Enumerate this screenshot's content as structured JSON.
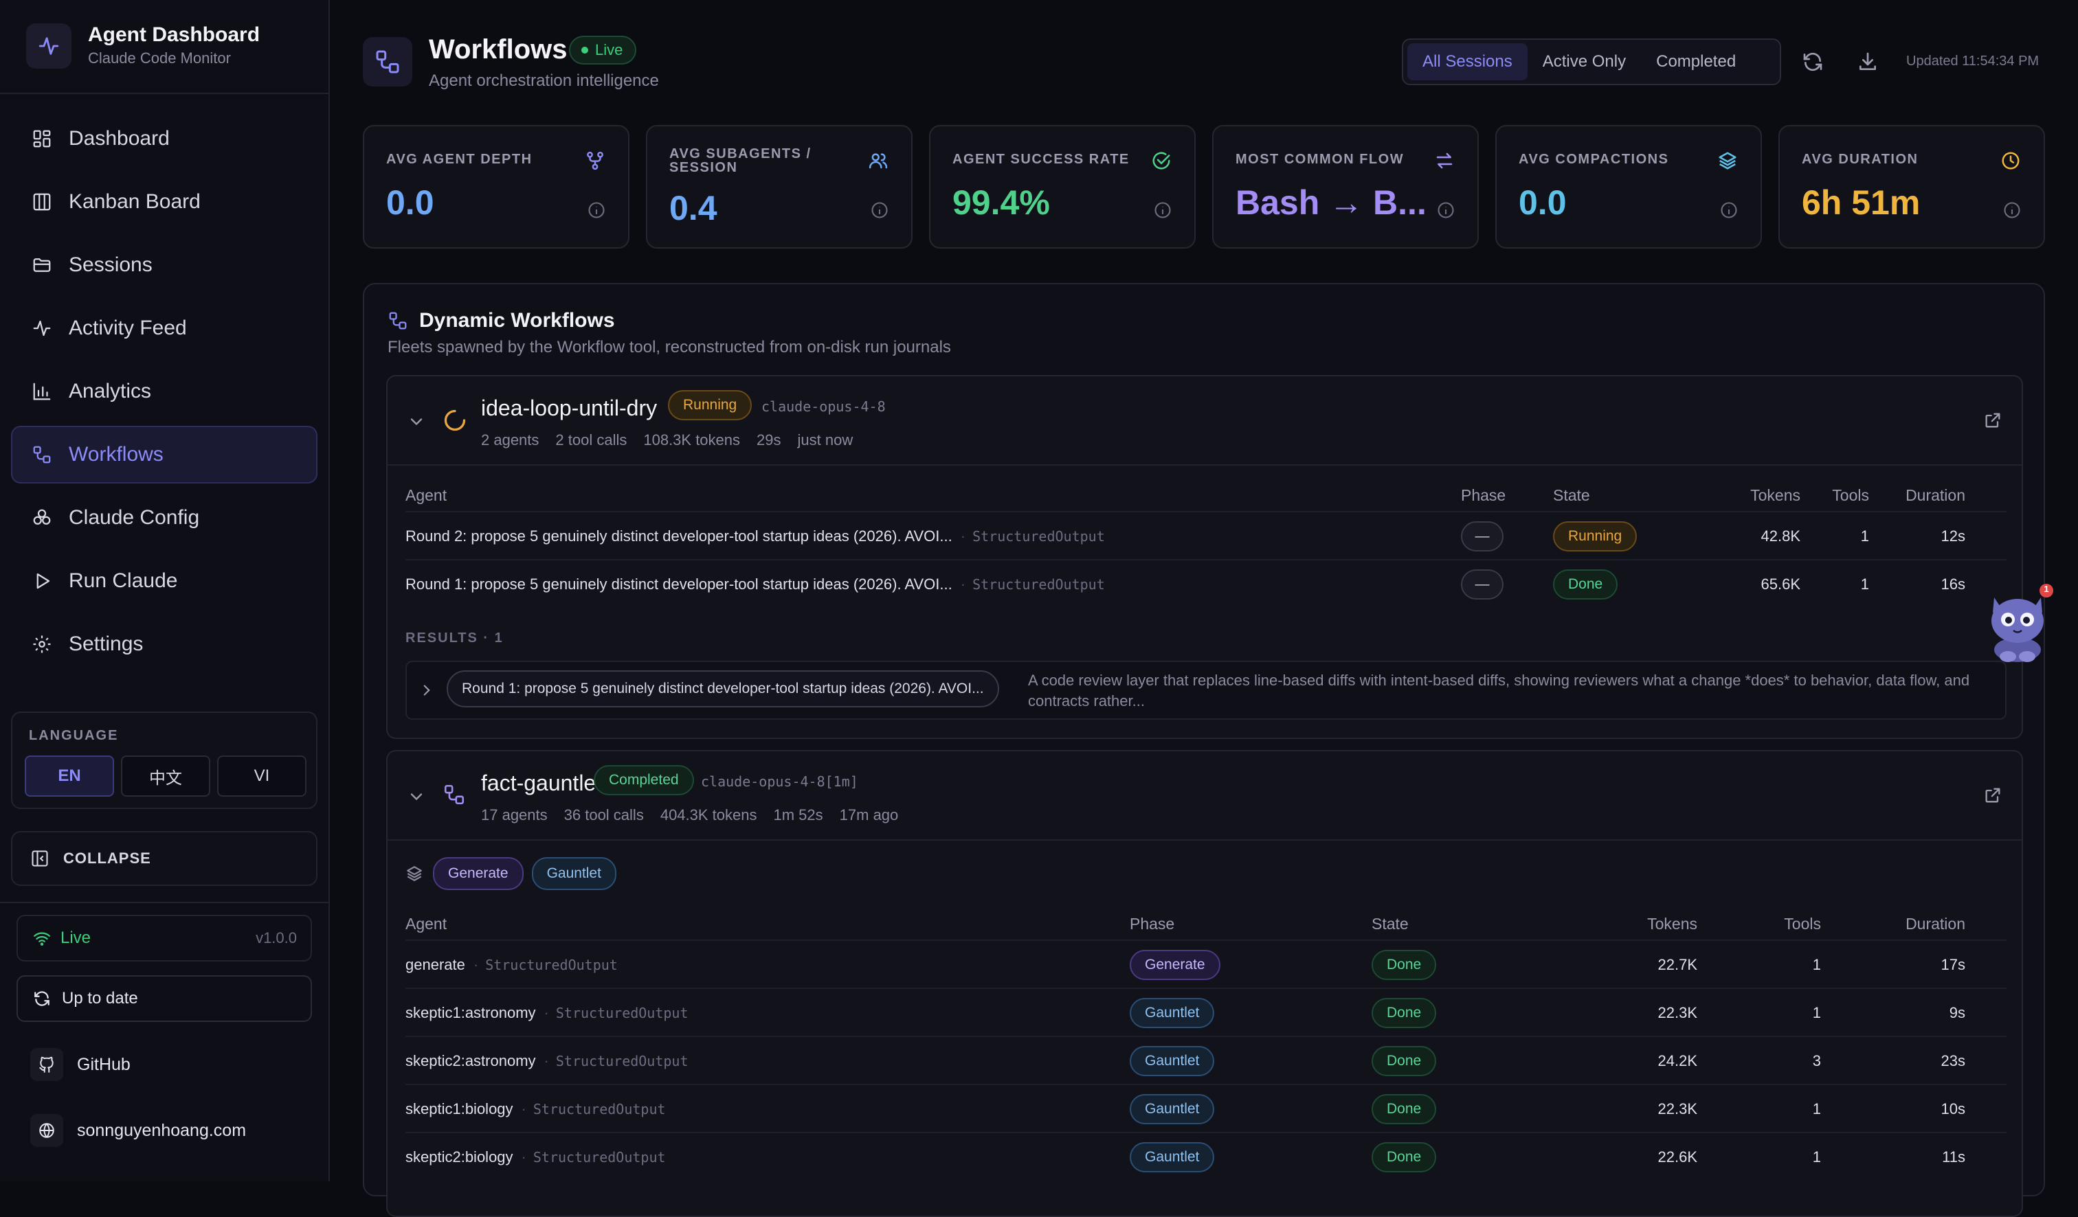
{
  "app": {
    "title": "Agent Dashboard",
    "subtitle": "Claude Code Monitor"
  },
  "nav": [
    {
      "label": "Dashboard",
      "icon": "dashboard-icon"
    },
    {
      "label": "Kanban Board",
      "icon": "kanban-icon"
    },
    {
      "label": "Sessions",
      "icon": "folder-icon"
    },
    {
      "label": "Activity Feed",
      "icon": "activity-icon"
    },
    {
      "label": "Analytics",
      "icon": "bar-chart-icon"
    },
    {
      "label": "Workflows",
      "icon": "workflow-icon",
      "active": true
    },
    {
      "label": "Claude Config",
      "icon": "config-icon"
    },
    {
      "label": "Run Claude",
      "icon": "play-icon"
    },
    {
      "label": "Settings",
      "icon": "gear-icon"
    }
  ],
  "language": {
    "title": "LANGUAGE",
    "options": [
      "EN",
      "中文",
      "VI"
    ],
    "selected": "EN"
  },
  "collapse_label": "COLLAPSE",
  "status": {
    "live": "Live",
    "version": "v1.0.0",
    "update": "Up to date"
  },
  "links": {
    "github": "GitHub",
    "website": "sonnguyenhoang.com"
  },
  "header": {
    "title": "Workflows",
    "live_badge": "Live",
    "subtitle": "Agent orchestration intelligence",
    "filters": [
      "All Sessions",
      "Active Only",
      "Completed"
    ],
    "active_filter": "All Sessions",
    "updated": "Updated 11:54:34 PM"
  },
  "stats": [
    {
      "label": "AVG AGENT DEPTH",
      "value": "0.0",
      "color": "#6fa8f5",
      "icon": "fork-icon"
    },
    {
      "label": "AVG SUBAGENTS / SESSION",
      "value": "0.4",
      "color": "#6fa8f5",
      "icon": "users-icon"
    },
    {
      "label": "AGENT SUCCESS RATE",
      "value": "99.4%",
      "color": "#4fd18b",
      "icon": "check-circle-icon"
    },
    {
      "label": "MOST COMMON FLOW",
      "value": "Bash → B...",
      "color": "#a48cf5",
      "icon": "swap-icon"
    },
    {
      "label": "AVG COMPACTIONS",
      "value": "0.0",
      "color": "#5ec2e8",
      "icon": "layers-icon"
    },
    {
      "label": "AVG DURATION",
      "value": "6h 51m",
      "color": "#f0b53c",
      "icon": "clock-icon"
    }
  ],
  "panel": {
    "title": "Dynamic Workflows",
    "subtitle": "Fleets spawned by the Workflow tool, reconstructed from on-disk run journals"
  },
  "workflows": [
    {
      "name": "idea-loop-until-dry",
      "status": "Running",
      "model": "claude-opus-4-8",
      "meta": [
        "2 agents",
        "2 tool calls",
        "108.3K tokens",
        "29s",
        "just now"
      ],
      "columns": [
        "Agent",
        "Phase",
        "State",
        "Tokens",
        "Tools",
        "Duration"
      ],
      "rows": [
        {
          "agent": "Round 2: propose 5 genuinely distinct developer-tool startup ideas (2026). AVOI...",
          "tool": "StructuredOutput",
          "phase": "—",
          "state": "Running",
          "tokens": "42.8K",
          "tools": "1",
          "duration": "12s"
        },
        {
          "agent": "Round 1: propose 5 genuinely distinct developer-tool startup ideas (2026). AVOI...",
          "tool": "StructuredOutput",
          "phase": "—",
          "state": "Done",
          "tokens": "65.6K",
          "tools": "1",
          "duration": "16s"
        }
      ],
      "results_label": "RESULTS · 1",
      "result": {
        "title": "Round 1: propose 5 genuinely distinct developer-tool startup ideas (2026). AVOI...",
        "text": "A code review layer that replaces line-based diffs with intent-based diffs, showing reviewers what a change *does* to behavior, data flow, and contracts rather..."
      }
    },
    {
      "name": "fact-gauntlet",
      "status": "Completed",
      "model": "claude-opus-4-8[1m]",
      "meta": [
        "17 agents",
        "36 tool calls",
        "404.3K tokens",
        "1m 52s",
        "17m ago"
      ],
      "phases": [
        "Generate",
        "Gauntlet"
      ],
      "columns": [
        "Agent",
        "Phase",
        "State",
        "Tokens",
        "Tools",
        "Duration"
      ],
      "rows": [
        {
          "agent": "generate",
          "tool": "StructuredOutput",
          "phase": "Generate",
          "state": "Done",
          "tokens": "22.7K",
          "tools": "1",
          "duration": "17s"
        },
        {
          "agent": "skeptic1:astronomy",
          "tool": "StructuredOutput",
          "phase": "Gauntlet",
          "state": "Done",
          "tokens": "22.3K",
          "tools": "1",
          "duration": "9s"
        },
        {
          "agent": "skeptic2:astronomy",
          "tool": "StructuredOutput",
          "phase": "Gauntlet",
          "state": "Done",
          "tokens": "24.2K",
          "tools": "3",
          "duration": "23s"
        },
        {
          "agent": "skeptic1:biology",
          "tool": "StructuredOutput",
          "phase": "Gauntlet",
          "state": "Done",
          "tokens": "22.3K",
          "tools": "1",
          "duration": "10s"
        },
        {
          "agent": "skeptic2:biology",
          "tool": "StructuredOutput",
          "phase": "Gauntlet",
          "state": "Done",
          "tokens": "22.6K",
          "tools": "1",
          "duration": "11s"
        }
      ]
    }
  ],
  "mascot": {
    "badge_count": "1"
  }
}
